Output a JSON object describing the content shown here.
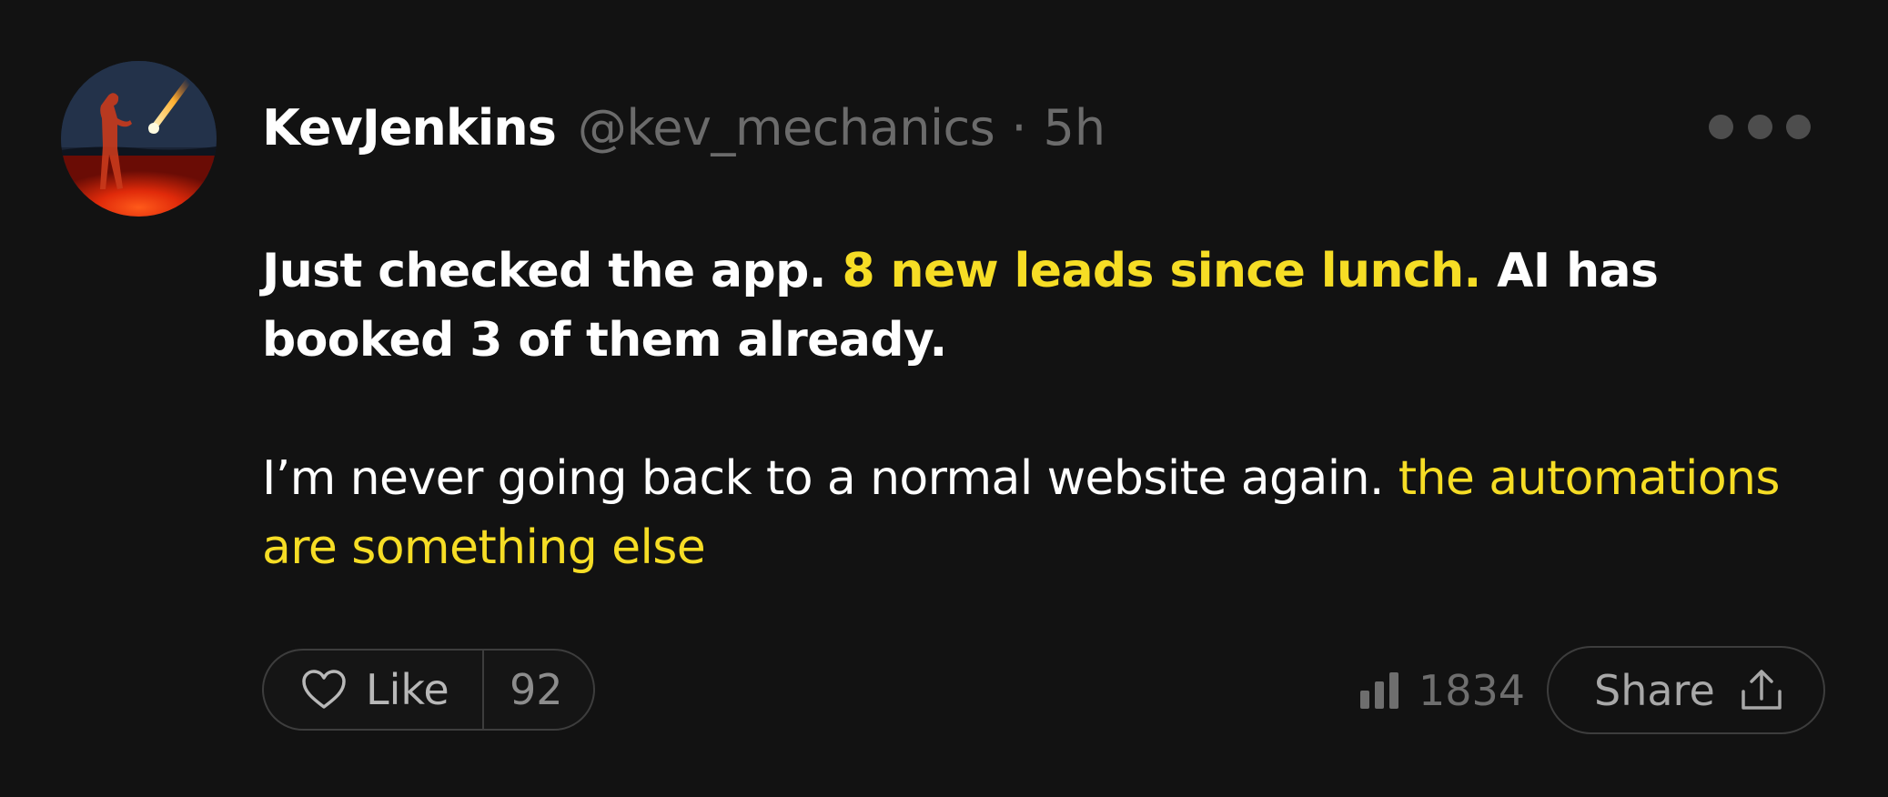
{
  "post": {
    "author_name": "KevJenkins",
    "handle": "@kev_mechanics",
    "separator": "·",
    "time": "5h",
    "more_icon": "more-horizontal-icon",
    "avatar_icon": "avatar-photo",
    "paragraph1": {
      "lead": "Just checked the app. ",
      "highlight": "8 new leads since lunch.",
      "rest": " AI has booked 3 of them already."
    },
    "paragraph2": {
      "lead": "I’m never going back to a normal website again. ",
      "highlight": "the automations are something else"
    }
  },
  "actions": {
    "like_label": "Like",
    "like_count": "92",
    "like_icon": "heart-icon",
    "views_count": "1834",
    "views_icon": "bar-chart-icon",
    "share_label": "Share",
    "share_icon": "share-upload-icon"
  },
  "colors": {
    "background": "#121212",
    "highlight": "#f6dd25",
    "muted": "#6b6b6b",
    "border": "#3d3d3d"
  }
}
